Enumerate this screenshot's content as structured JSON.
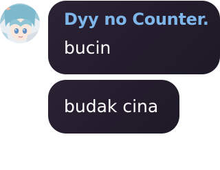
{
  "conversation": {
    "sender_name": "Dyy no Counter.",
    "messages": [
      {
        "text": "bucin"
      },
      {
        "text": "budak cina"
      }
    ]
  },
  "avatar": {
    "icon": "anime-avatar-icon"
  },
  "colors": {
    "bubble_background": "#2b2234",
    "sender_name": "#7fb6ea",
    "message_text": "#ffffff",
    "page_background": "#ffffff"
  }
}
